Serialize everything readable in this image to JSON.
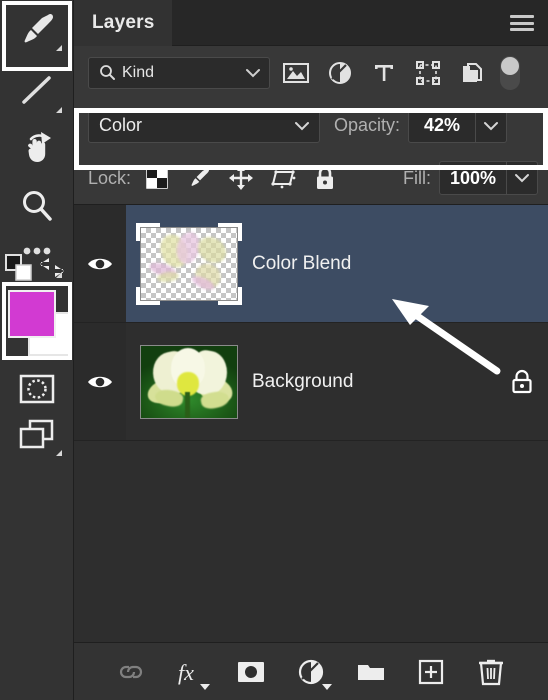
{
  "panel": {
    "tab_label": "Layers",
    "menu_icon": "hamburger-menu-icon"
  },
  "filter": {
    "search_icon": "search-icon",
    "kind_label": "Kind",
    "chevron_icon": "chevron-down-icon",
    "icons": [
      {
        "name": "pixel-layer-filter-icon",
        "label": "Pixel Layers"
      },
      {
        "name": "adjustment-layer-filter-icon",
        "label": "Adjustment Layers"
      },
      {
        "name": "type-layer-filter-icon",
        "label": "Type Layers"
      },
      {
        "name": "shape-layer-filter-icon",
        "label": "Shape Layers"
      },
      {
        "name": "smart-object-filter-icon",
        "label": "Smart Objects"
      }
    ],
    "toggle_name": "filter-enable-toggle"
  },
  "blend": {
    "mode_value": "Color",
    "mode_chevron_icon": "chevron-down-icon",
    "opacity_label": "Opacity:",
    "opacity_value": "42%",
    "opacity_chevron_icon": "chevron-down-icon"
  },
  "lock": {
    "label": "Lock:",
    "icons": [
      {
        "name": "lock-transparent-pixels-icon",
        "label": "Lock transparent pixels"
      },
      {
        "name": "lock-image-pixels-icon",
        "label": "Lock image pixels"
      },
      {
        "name": "lock-position-icon",
        "label": "Lock position"
      },
      {
        "name": "lock-artboard-nesting-icon",
        "label": "Prevent auto-nesting"
      },
      {
        "name": "lock-all-icon",
        "label": "Lock all"
      }
    ],
    "fill_label": "Fill:",
    "fill_value": "100%",
    "fill_chevron_icon": "chevron-down-icon"
  },
  "layers": [
    {
      "name": "Color Blend",
      "selected": true,
      "visible": true,
      "visibility_icon": "eye-icon",
      "thumbnail_type": "transparent-checkerboard",
      "locked": false,
      "lock_icon": ""
    },
    {
      "name": "Background",
      "selected": false,
      "visible": true,
      "visibility_icon": "eye-icon",
      "thumbnail_type": "photo-lotus-flower",
      "locked": true,
      "lock_icon": "lock-icon"
    }
  ],
  "bottom_bar": {
    "buttons": [
      {
        "name": "link-layers-button",
        "icon": "link-icon",
        "label": "Link layers",
        "disabled": true
      },
      {
        "name": "layer-style-button",
        "icon": "fx-icon",
        "label": "Add a layer style",
        "disabled": false
      },
      {
        "name": "layer-mask-button",
        "icon": "mask-icon",
        "label": "Add layer mask",
        "disabled": false
      },
      {
        "name": "adjustment-layer-button",
        "icon": "half-circle-icon",
        "label": "New fill or adjustment layer",
        "disabled": false
      },
      {
        "name": "new-group-button",
        "icon": "folder-icon",
        "label": "Create a new group",
        "disabled": false
      },
      {
        "name": "new-layer-button",
        "icon": "plus-square-icon",
        "label": "Create a new layer",
        "disabled": false
      },
      {
        "name": "delete-layer-button",
        "icon": "trash-icon",
        "label": "Delete layer",
        "disabled": false
      }
    ]
  },
  "toolbar": {
    "tools": [
      {
        "name": "brush-tool",
        "icon": "brush-icon",
        "active": true,
        "has_flyout": true
      },
      {
        "name": "gradient-tool",
        "icon": "line-gradient-icon",
        "active": false,
        "has_flyout": true
      },
      {
        "name": "rotate-view-tool",
        "icon": "hand-rotate-icon",
        "active": false,
        "has_flyout": false
      },
      {
        "name": "zoom-tool",
        "icon": "magnifier-icon",
        "active": false,
        "has_flyout": false
      },
      {
        "name": "edit-toolbar-button",
        "icon": "ellipsis-icon",
        "active": false,
        "has_flyout": true
      }
    ],
    "foreground_color": "#d23ad2",
    "background_color": "#ffffff",
    "default_colors_icon": "default-colors-icon",
    "swap_colors_icon": "swap-colors-icon",
    "quick_mask_icon": "quick-mask-icon",
    "screen_mode_icon": "screen-mode-icon"
  },
  "annotations": {
    "highlight_boxes": [
      {
        "name": "blend-mode-row-highlight",
        "color": "#ffffff"
      },
      {
        "name": "brush-tool-highlight",
        "color": "#ffffff"
      },
      {
        "name": "foreground-color-highlight",
        "color": "#ffffff"
      }
    ],
    "arrow": {
      "name": "pointer-arrow",
      "color": "#ffffff",
      "points_to": "Color Blend layer row"
    }
  },
  "colors": {
    "panel_bg": "#2e2e2e",
    "row_bg": "#383838",
    "selected_row": "#3d4c63",
    "toolbar_bg": "#333333",
    "accent_magenta": "#d23ad2"
  }
}
